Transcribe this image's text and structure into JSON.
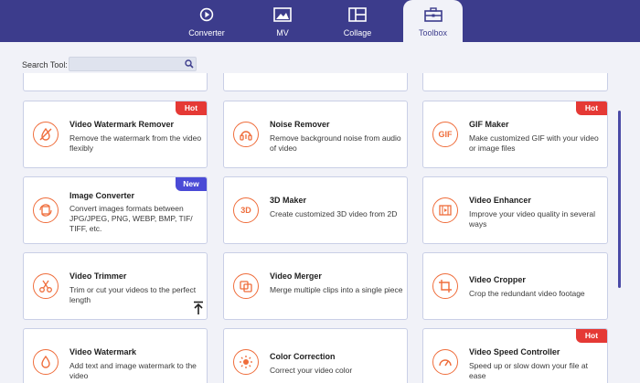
{
  "tabs": [
    {
      "label": "Converter",
      "icon": "converter-icon"
    },
    {
      "label": "MV",
      "icon": "mv-icon"
    },
    {
      "label": "Collage",
      "icon": "collage-icon"
    },
    {
      "label": "Toolbox",
      "icon": "toolbox-icon",
      "active": true
    }
  ],
  "search": {
    "label": "Search Tool:",
    "placeholder": ""
  },
  "colors": {
    "topbar": "#3c3c8c",
    "accent": "#ef6d3b",
    "hot": "#e53935",
    "new": "#4a4ad6"
  },
  "tools": [
    {
      "title": "Video Watermark Remover",
      "desc": "Remove the watermark from the video flexibly",
      "badge": "Hot",
      "icon": "watermark-remover-icon"
    },
    {
      "title": "Noise Remover",
      "desc": "Remove background noise from audio of video",
      "badge": "",
      "icon": "noise-remover-icon"
    },
    {
      "title": "GIF Maker",
      "desc": "Make customized GIF with your video or image files",
      "badge": "Hot",
      "icon": "gif-icon",
      "icon_text": "GIF"
    },
    {
      "title": "Image Converter",
      "desc": "Convert images formats between JPG/JPEG, PNG, WEBP, BMP, TIF/ TIFF, etc.",
      "badge": "New",
      "icon": "image-converter-icon"
    },
    {
      "title": "3D Maker",
      "desc": "Create customized 3D video from 2D",
      "badge": "",
      "icon": "3d-icon",
      "icon_text": "3D"
    },
    {
      "title": "Video Enhancer",
      "desc": "Improve your video quality in several ways",
      "badge": "",
      "icon": "video-enhancer-icon"
    },
    {
      "title": "Video Trimmer",
      "desc": "Trim or cut your videos to the perfect length",
      "badge": "",
      "icon": "scissors-icon"
    },
    {
      "title": "Video Merger",
      "desc": "Merge multiple clips into a single piece",
      "badge": "",
      "icon": "merge-icon"
    },
    {
      "title": "Video Cropper",
      "desc": "Crop the redundant video footage",
      "badge": "",
      "icon": "crop-icon"
    },
    {
      "title": "Video Watermark",
      "desc": "Add text and image watermark to the video",
      "badge": "",
      "icon": "watermark-icon"
    },
    {
      "title": "Color Correction",
      "desc": "Correct your video color",
      "badge": "",
      "icon": "color-correction-icon"
    },
    {
      "title": "Video Speed Controller",
      "desc": "Speed up or slow down your file at ease",
      "badge": "Hot",
      "icon": "speed-icon"
    }
  ]
}
